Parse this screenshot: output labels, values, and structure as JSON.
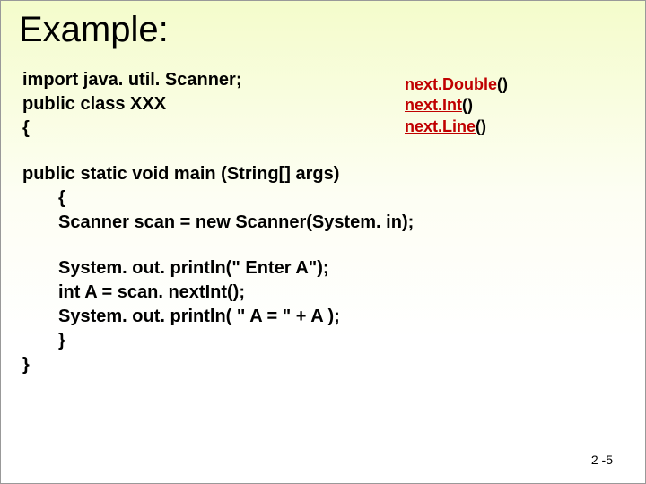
{
  "title": "Example:",
  "code": {
    "l1": "import java. util. Scanner;",
    "l2": "public class XXX",
    "l3": "{",
    "l4": "public static void main (String[] args)",
    "l5": "{",
    "l6": "Scanner scan = new Scanner(System. in);",
    "l7": "System. out. println(\" Enter A\");",
    "l8": "int A = scan. nextInt();",
    "l9": "System. out. println( \" A = \" + A );",
    "l10": "}",
    "l11": "}"
  },
  "methods": {
    "m1a": "next.Double",
    "m1b": "()",
    "m2a": "next.Int",
    "m2b": "()",
    "m3a": "next.Line",
    "m3b": "()"
  },
  "pagenum": "2 -5"
}
